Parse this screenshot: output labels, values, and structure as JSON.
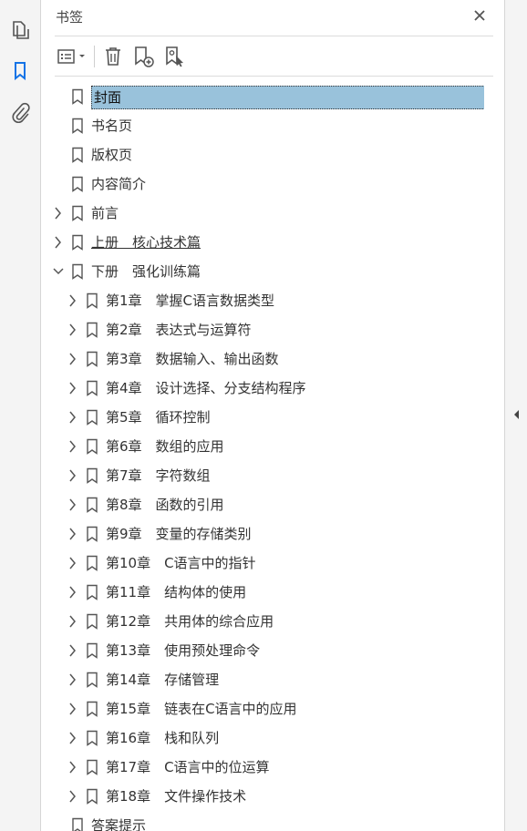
{
  "rail": {
    "items": [
      {
        "name": "page-thumbnails-icon",
        "active": false
      },
      {
        "name": "bookmarks-icon",
        "active": true
      },
      {
        "name": "attachments-icon",
        "active": false
      }
    ]
  },
  "panel": {
    "title": "书签",
    "toolbar": [
      {
        "name": "options-menu-button",
        "icon": "list-options-icon"
      },
      {
        "name": "delete-bookmark-button",
        "icon": "trash-icon"
      },
      {
        "name": "new-bookmark-button",
        "icon": "bookmark-add-icon"
      },
      {
        "name": "new-bookmark-from-structure-button",
        "icon": "bookmark-cursor-icon"
      }
    ]
  },
  "bookmarks": [
    {
      "level": 0,
      "label": "封面",
      "expander": "none",
      "selected": true
    },
    {
      "level": 0,
      "label": "书名页",
      "expander": "none"
    },
    {
      "level": 0,
      "label": "版权页",
      "expander": "none"
    },
    {
      "level": 0,
      "label": "内容简介",
      "expander": "none"
    },
    {
      "level": 0,
      "label": "前言",
      "expander": "collapsed"
    },
    {
      "level": 0,
      "label": "上册　核心技术篇",
      "expander": "collapsed",
      "underline": true
    },
    {
      "level": 0,
      "label": "下册　强化训练篇",
      "expander": "expanded"
    },
    {
      "level": 1,
      "label": "第1章　掌握C语言数据类型",
      "expander": "collapsed"
    },
    {
      "level": 1,
      "label": "第2章　表达式与运算符",
      "expander": "collapsed"
    },
    {
      "level": 1,
      "label": "第3章　数据输入、输出函数",
      "expander": "collapsed"
    },
    {
      "level": 1,
      "label": "第4章　设计选择、分支结构程序",
      "expander": "collapsed"
    },
    {
      "level": 1,
      "label": "第5章　循环控制",
      "expander": "collapsed"
    },
    {
      "level": 1,
      "label": "第6章　数组的应用",
      "expander": "collapsed"
    },
    {
      "level": 1,
      "label": "第7章　字符数组",
      "expander": "collapsed"
    },
    {
      "level": 1,
      "label": "第8章　函数的引用",
      "expander": "collapsed"
    },
    {
      "level": 1,
      "label": "第9章　变量的存储类别",
      "expander": "collapsed"
    },
    {
      "level": 1,
      "label": "第10章　C语言中的指针",
      "expander": "collapsed"
    },
    {
      "level": 1,
      "label": "第11章　结构体的使用",
      "expander": "collapsed"
    },
    {
      "level": 1,
      "label": "第12章　共用体的综合应用",
      "expander": "collapsed"
    },
    {
      "level": 1,
      "label": "第13章　使用预处理命令",
      "expander": "collapsed"
    },
    {
      "level": 1,
      "label": "第14章　存储管理",
      "expander": "collapsed"
    },
    {
      "level": 1,
      "label": "第15章　链表在C语言中的应用",
      "expander": "collapsed"
    },
    {
      "level": 1,
      "label": "第16章　栈和队列",
      "expander": "collapsed"
    },
    {
      "level": 1,
      "label": "第17章　C语言中的位运算",
      "expander": "collapsed"
    },
    {
      "level": 1,
      "label": "第18章　文件操作技术",
      "expander": "collapsed"
    },
    {
      "level": 0,
      "label": "答案提示",
      "expander": "none"
    }
  ],
  "colors": {
    "selection": "#99c2db",
    "accent": "#1473e6",
    "icon": "#555555"
  }
}
